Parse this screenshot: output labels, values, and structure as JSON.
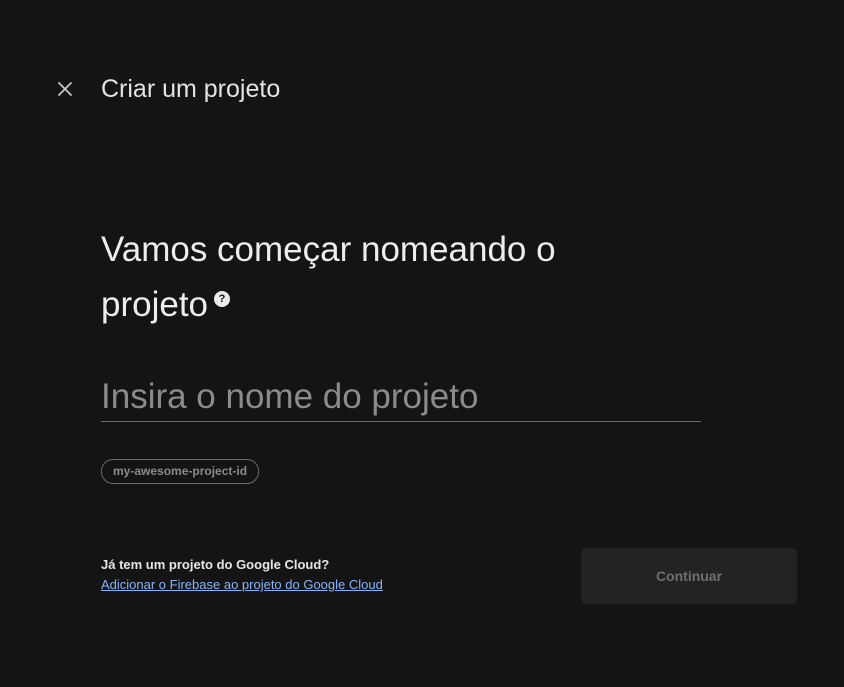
{
  "header": {
    "close_icon": "close-icon",
    "title": "Criar um projeto"
  },
  "main": {
    "heading": "Vamos começar nomeando o projeto",
    "help_icon": "help-icon",
    "help_glyph": "?",
    "project_name": {
      "value": "",
      "placeholder": "Insira o nome do projeto"
    },
    "project_id": "my-awesome-project-id"
  },
  "footer": {
    "question": "Já tem um projeto do Google Cloud?",
    "link": "Adicionar o Firebase ao projeto do Google Cloud",
    "continue_label": "Continuar",
    "continue_disabled": true
  },
  "colors": {
    "background": "#141414",
    "link": "#8ab4f8",
    "button_disabled_bg": "#232323"
  }
}
